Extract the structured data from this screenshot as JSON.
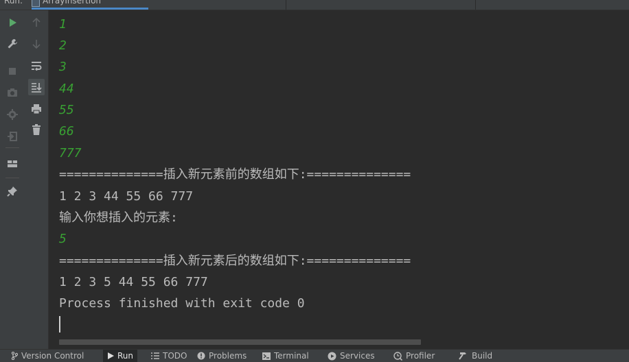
{
  "header": {
    "run_label": "Run:",
    "tab_label": "ArrayInsertion"
  },
  "toolbar_left": [
    {
      "name": "rerun-icon"
    },
    {
      "name": "wrench-icon"
    },
    {
      "name": "stop-icon"
    },
    {
      "name": "camera-icon"
    },
    {
      "name": "debug-settings-icon"
    },
    {
      "name": "exit-icon"
    },
    {
      "name": "layout-icon"
    },
    {
      "name": "pin-icon"
    }
  ],
  "toolbar_right": [
    {
      "name": "up-arrow-icon"
    },
    {
      "name": "down-arrow-icon"
    },
    {
      "name": "soft-wrap-icon"
    },
    {
      "name": "scroll-to-end-icon"
    },
    {
      "name": "print-icon"
    },
    {
      "name": "trash-icon"
    }
  ],
  "console": {
    "lines": [
      {
        "text": "1",
        "kind": "input"
      },
      {
        "text": "2",
        "kind": "input"
      },
      {
        "text": "3",
        "kind": "input"
      },
      {
        "text": "44",
        "kind": "input"
      },
      {
        "text": "55",
        "kind": "input"
      },
      {
        "text": "66",
        "kind": "input"
      },
      {
        "text": "777",
        "kind": "input"
      },
      {
        "text": "==============插入新元素前的数组如下:==============",
        "kind": "output"
      },
      {
        "text": "1 2 3 44 55 66 777",
        "kind": "output"
      },
      {
        "text": "输入你想插入的元素:",
        "kind": "output"
      },
      {
        "text": "5",
        "kind": "input"
      },
      {
        "text": "==============插入新元素后的数组如下:==============",
        "kind": "output"
      },
      {
        "text": "1 2 3 5 44 55 66 777",
        "kind": "output"
      },
      {
        "text": "Process finished with exit code 0",
        "kind": "output"
      }
    ]
  },
  "bottombar": {
    "version_control": "Version Control",
    "run": "Run",
    "todo": "TODO",
    "problems": "Problems",
    "terminal": "Terminal",
    "services": "Services",
    "profiler": "Profiler",
    "build": "Build"
  },
  "colors": {
    "input_text": "#39a033",
    "output_text": "#bbbbbb",
    "run_icon": "#59a869",
    "accent": "#4a88c7"
  }
}
